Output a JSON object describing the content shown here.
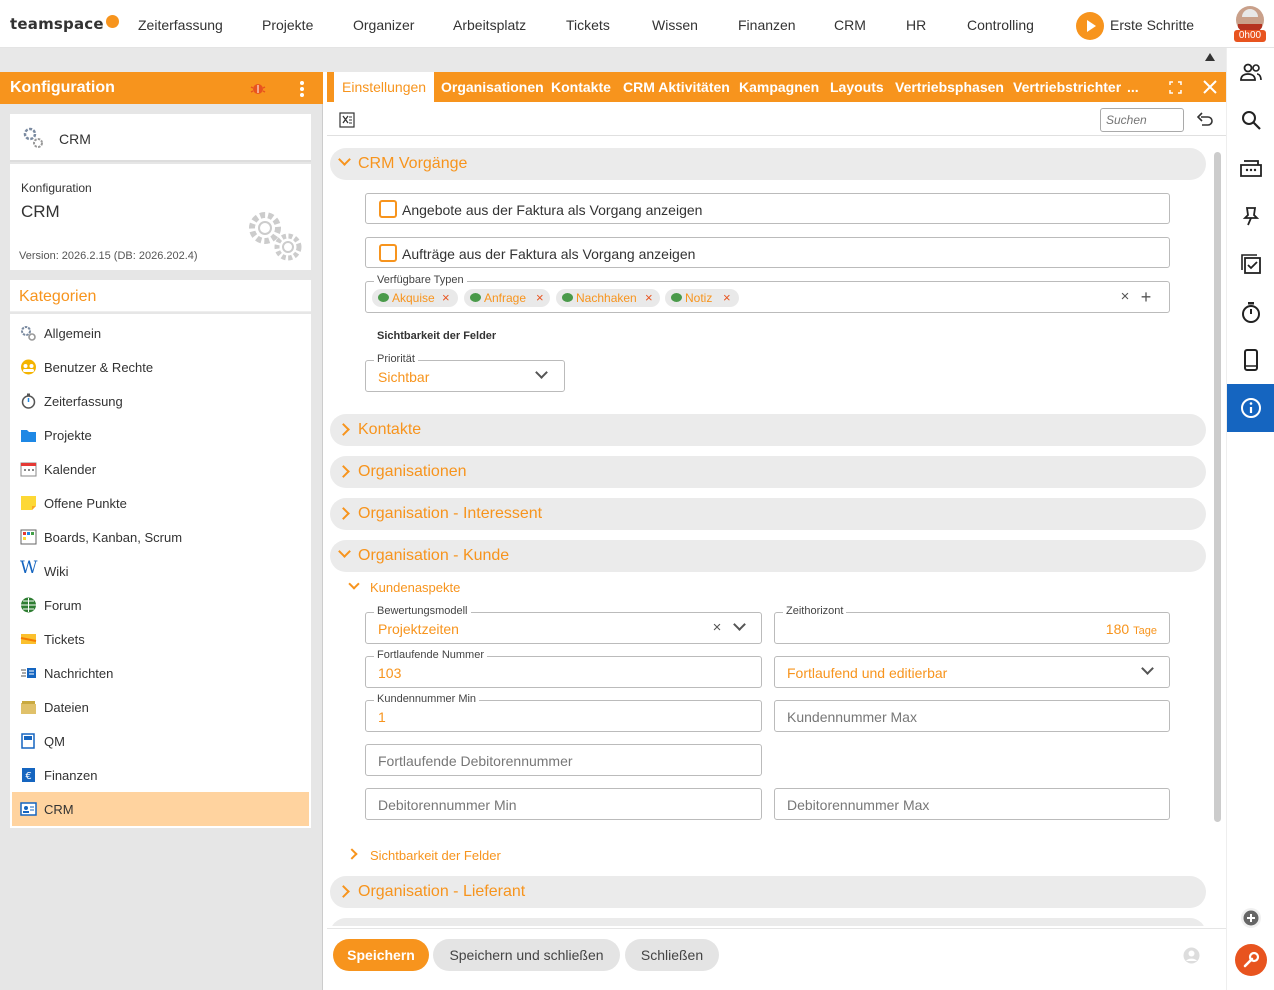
{
  "app": {
    "logo": "teamspace"
  },
  "nav": [
    "Zeiterfassung",
    "Projekte",
    "Organizer",
    "Arbeitsplatz",
    "Tickets",
    "Wissen",
    "Finanzen",
    "CRM",
    "HR",
    "Controlling"
  ],
  "erste_schritte": "Erste Schritte",
  "timer": "0h00",
  "left": {
    "header": "Konfiguration",
    "card_title": "CRM",
    "info_label": "Konfiguration",
    "info_title": "CRM",
    "version": "Version: 2026.2.15 (DB: 2026.202.4)",
    "kategorien_title": "Kategorien",
    "categories": [
      {
        "label": "Allgemein",
        "icon": "gears-icon"
      },
      {
        "label": "Benutzer & Rechte",
        "icon": "users-icon"
      },
      {
        "label": "Zeiterfassung",
        "icon": "stopwatch-icon"
      },
      {
        "label": "Projekte",
        "icon": "folder-icon"
      },
      {
        "label": "Kalender",
        "icon": "calendar-icon"
      },
      {
        "label": "Offene Punkte",
        "icon": "sticky-note-icon"
      },
      {
        "label": "Boards, Kanban, Scrum",
        "icon": "board-icon"
      },
      {
        "label": "Wiki",
        "icon": "wiki-icon"
      },
      {
        "label": "Forum",
        "icon": "forum-icon"
      },
      {
        "label": "Tickets",
        "icon": "ticket-icon"
      },
      {
        "label": "Nachrichten",
        "icon": "messages-icon"
      },
      {
        "label": "Dateien",
        "icon": "files-icon"
      },
      {
        "label": "QM",
        "icon": "qm-icon"
      },
      {
        "label": "Finanzen",
        "icon": "finance-icon"
      },
      {
        "label": "CRM",
        "icon": "crm-icon"
      }
    ],
    "active_category": "CRM"
  },
  "tabs": [
    "Einstellungen",
    "Organisationen",
    "Kontakte",
    "CRM Aktivitäten",
    "Kampagnen",
    "Layouts",
    "Vertriebsphasen",
    "Vertriebstrichter",
    "..."
  ],
  "active_tab": "Einstellungen",
  "search_placeholder": "Suchen",
  "sections": {
    "crm_vorgaenge": "CRM Vorgänge",
    "checkbox1": "Angebote aus der Faktura als Vorgang anzeigen",
    "checkbox2": "Aufträge aus der Faktura als Vorgang anzeigen",
    "typen_label": "Verfügbare Typen",
    "typen": [
      "Akquise",
      "Anfrage",
      "Nachhaken",
      "Notiz"
    ],
    "sichtbarkeit": "Sichtbarkeit der Felder",
    "prioritaet_label": "Priorität",
    "prioritaet_value": "Sichtbar",
    "kontakte": "Kontakte",
    "organisationen": "Organisationen",
    "org_interessent": "Organisation - Interessent",
    "org_kunde": "Organisation - Kunde",
    "kundenaspekte": "Kundenaspekte",
    "bewertungsmodell_label": "Bewertungsmodell",
    "bewertungsmodell_value": "Projektzeiten",
    "zeithorizont_label": "Zeithorizont",
    "zeithorizont_value": "180",
    "zeithorizont_unit": "Tage",
    "fortlaufende_label": "Fortlaufende Nummer",
    "fortlaufende_value": "103",
    "fortlaufend_mode": "Fortlaufend und editierbar",
    "kundennr_min_label": "Kundennummer Min",
    "kundennr_min_value": "1",
    "kundennr_max_ph": "Kundennummer Max",
    "debitor_fortl_ph": "Fortlaufende Debitorennummer",
    "debitor_min_ph": "Debitorennummer Min",
    "debitor_max_ph": "Debitorennummer Max",
    "sichtbarkeit2": "Sichtbarkeit der Felder",
    "org_lieferant": "Organisation - Lieferant"
  },
  "footer": {
    "save": "Speichern",
    "save_close": "Speichern und schließen",
    "close": "Schließen"
  },
  "colors": {
    "accent": "#f7941d",
    "rail_active": "#1565c0",
    "danger": "#e8541f"
  }
}
